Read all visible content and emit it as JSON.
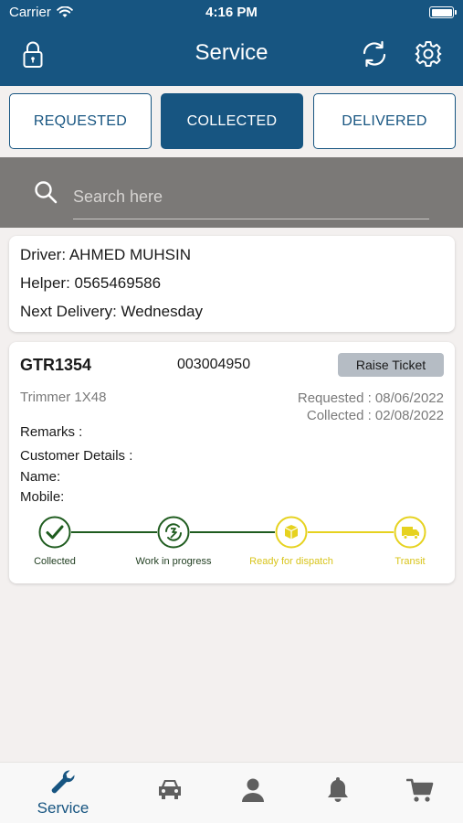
{
  "status_bar": {
    "carrier": "Carrier",
    "time": "4:16 PM"
  },
  "header": {
    "title": "Service",
    "lock_icon": "lock-icon",
    "refresh_icon": "refresh-icon",
    "settings_icon": "gear-icon"
  },
  "tabs": [
    {
      "label": "REQUESTED",
      "active": false
    },
    {
      "label": "COLLECTED",
      "active": true
    },
    {
      "label": "DELIVERED",
      "active": false
    }
  ],
  "search": {
    "placeholder": "Search here",
    "value": ""
  },
  "driver_card": {
    "driver": "Driver: AHMED MUHSIN",
    "helper": "Helper: 0565469586",
    "next_delivery": "Next Delivery: Wednesday"
  },
  "service_card": {
    "code": "GTR1354",
    "order_number": "003004950",
    "raise_ticket_label": "Raise Ticket",
    "product": "Trimmer 1X48",
    "requested": "Requested : 08/06/2022",
    "collected": "Collected : 02/08/2022",
    "remarks": "Remarks :",
    "customer_details": "Customer Details :",
    "name": "Name:",
    "mobile": "Mobile:",
    "steps": [
      {
        "label": "Collected",
        "state": "done",
        "icon": "check-icon"
      },
      {
        "label": "Work in progress",
        "state": "done",
        "icon": "work-progress-icon"
      },
      {
        "label": "Ready for dispatch",
        "state": "pending",
        "icon": "package-icon"
      },
      {
        "label": "Transit",
        "state": "pending",
        "icon": "truck-icon"
      }
    ]
  },
  "bottom_tabs": [
    {
      "label": "Service",
      "icon": "wrench-icon",
      "active": true
    },
    {
      "label": "",
      "icon": "car-icon",
      "active": false
    },
    {
      "label": "",
      "icon": "person-icon",
      "active": false
    },
    {
      "label": "",
      "icon": "bell-icon",
      "active": false
    },
    {
      "label": "",
      "icon": "cart-icon",
      "active": false
    }
  ],
  "colors": {
    "primary": "#175581",
    "done_green": "#1f5c1f",
    "pending_yellow": "#e6d21f",
    "search_band": "#7b7977"
  }
}
